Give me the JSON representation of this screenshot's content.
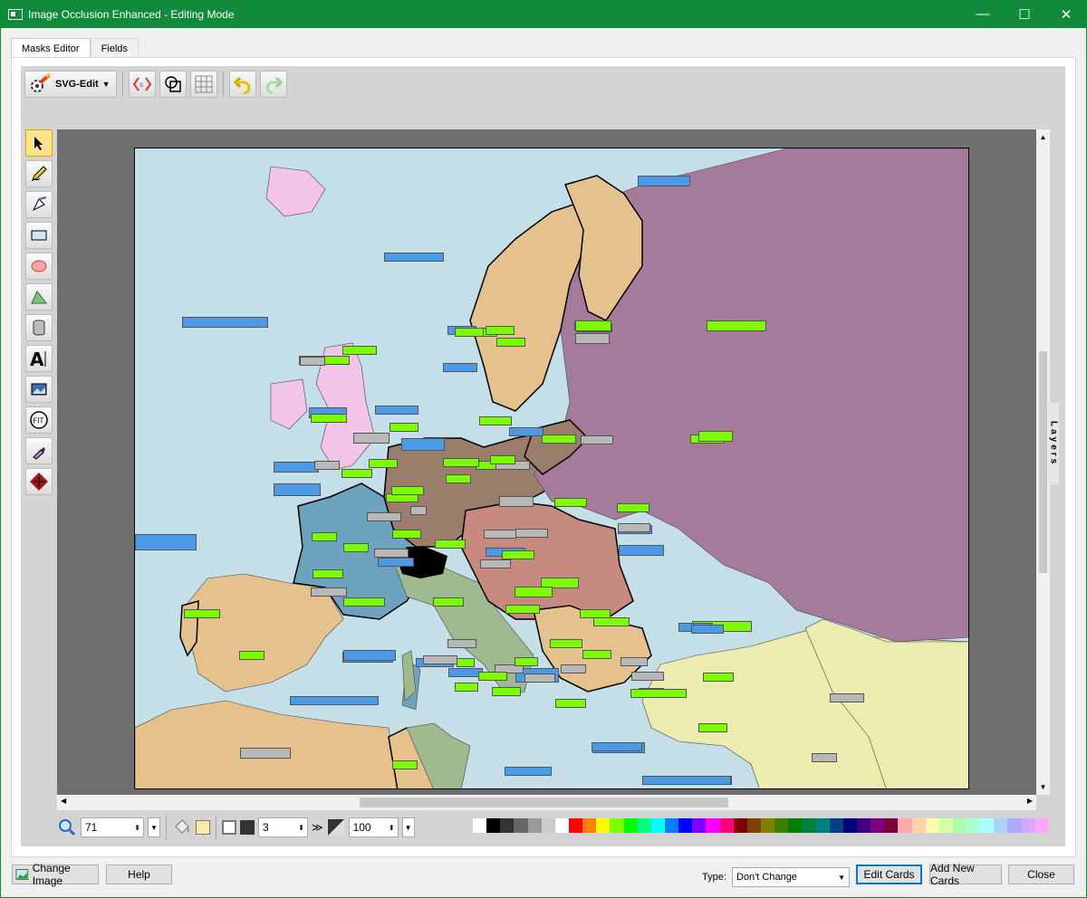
{
  "window": {
    "title": "Image Occlusion Enhanced - Editing Mode",
    "minimize": "—",
    "maximize": "☐",
    "close": "✕"
  },
  "tabs": [
    {
      "label": "Masks Editor"
    },
    {
      "label": "Fields"
    }
  ],
  "toolbar": {
    "svg_edit_label": "SVG-Edit"
  },
  "sidepanel": {
    "layers_label": "Layers"
  },
  "bottom": {
    "zoom_value": "71",
    "stroke_width": "3",
    "opacity": "100",
    "more": "≫"
  },
  "footer": {
    "change_image": "Change Image",
    "help": "Help",
    "type_label": "Type:",
    "type_value": "Don't Change",
    "edit_cards": "Edit Cards",
    "add_new_cards": "Add New Cards",
    "close": "Close"
  },
  "colors": {
    "titlebar": "#118a3c",
    "sea": "#c5dfe9",
    "mask_green": "#7cfc00",
    "mask_blue": "#4a9ae8",
    "mask_gray": "#b8b8b8",
    "russia": "#a57b9b",
    "sand": "#e5c18e",
    "germany": "#9a7d6a",
    "france": "#6ea3bf",
    "italy": "#9fba8e",
    "uk": "#f2c4e8",
    "turkey": "#ecebb0",
    "balkans": "#c68a7e"
  },
  "palette": [
    "#ffffff",
    "#000000",
    "#333333",
    "#666666",
    "#999999",
    "#cccccc",
    "#ffffff",
    "#ff0000",
    "#ff7f00",
    "#ffff00",
    "#7fff00",
    "#00ff00",
    "#00ff7f",
    "#00ffff",
    "#007fff",
    "#0000ff",
    "#7f00ff",
    "#ff00ff",
    "#ff007f",
    "#7f0000",
    "#7f3f00",
    "#7f7f00",
    "#3f7f00",
    "#007f00",
    "#007f3f",
    "#007f7f",
    "#003f7f",
    "#00007f",
    "#3f007f",
    "#7f007f",
    "#7f003f",
    "#ffaaaa",
    "#ffd4aa",
    "#ffffaa",
    "#d4ffaa",
    "#aaffaa",
    "#aaffd4",
    "#aaffff",
    "#aad4ff",
    "#aaaaff",
    "#d4aaff",
    "#ffaaff"
  ]
}
